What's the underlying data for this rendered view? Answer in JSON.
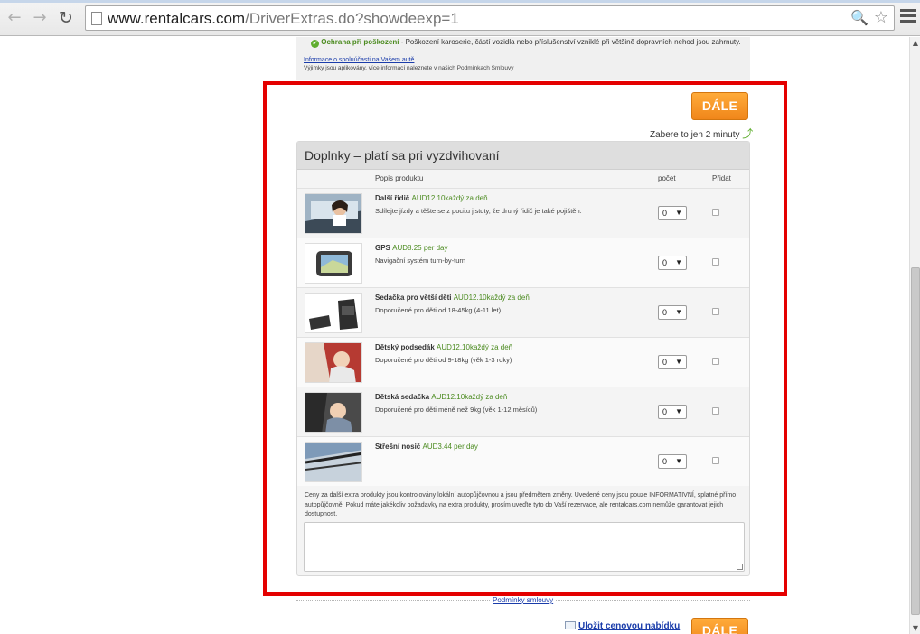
{
  "browser": {
    "url_host": "www.rentalcars.com",
    "url_path": "/DriverExtras.do?showdeexp=1",
    "back_glyph": "←",
    "forward_glyph": "→",
    "reload_glyph": "↻",
    "zoom_glyph": "🔍",
    "star_glyph": "☆"
  },
  "coverage": {
    "check_glyph": "✔",
    "title": "Ochrana při poškození",
    "text": " - Poškození karoserie, částí vozidla nebo příslušenství vzniklé při většině dopravních nehod jsou zahrnuty.",
    "excess_link": "Informace o spoluúčasti na Vašem autě",
    "exclusions_note": "Výjimky jsou aplikovány, více informací naleznete v našich Podmínkach Smlouvy"
  },
  "continue_label": "DÁLE",
  "takes_time": "Zabere to jen 2 minuty",
  "takes_arrow": "⤴",
  "extras": {
    "title": "Doplnky – platí sa pri vyzdvihovaní",
    "col_product": "Popis produktu",
    "col_count": "počet",
    "col_add": "Přidat",
    "items": [
      {
        "name": "Další řidič",
        "price": "AUD12.10každý za deň",
        "desc": "Sdílejte jízdy a těšte se z pocitu jistoty, že druhý řidič je také pojištěn.",
        "qty": "0",
        "thumb": "driver-photo"
      },
      {
        "name": "GPS",
        "price": "AUD8.25 per day",
        "desc": "Navigační systém turn-by-turn",
        "qty": "0",
        "thumb": "gps-photo"
      },
      {
        "name": "Sedačka pro větší děti",
        "price": "AUD12.10každý za deň",
        "desc": "Doporučené pro děti od 18-45kg (4-11 let)",
        "qty": "0",
        "thumb": "booster-seat-photo"
      },
      {
        "name": "Dětský podsedák",
        "price": "AUD12.10každý za deň",
        "desc": "Doporučené pro děti od 9-18kg (věk 1-3 roky)",
        "qty": "0",
        "thumb": "child-seat-photo"
      },
      {
        "name": "Dětská sedačka",
        "price": "AUD12.10každý za deň",
        "desc": "Doporučené pro děti méně než 9kg (věk 1-12 měsíců)",
        "qty": "0",
        "thumb": "baby-seat-photo"
      },
      {
        "name": "Střešní nosič",
        "price": "AUD3.44 per day",
        "desc": "",
        "qty": "0",
        "thumb": "roof-rack-photo"
      }
    ],
    "caret_glyph": "▼",
    "disclaimer": "Ceny za další extra produkty jsou kontrolovány lokální autopůjčovnou a jsou předmětem změny. Uvedené ceny jsou pouze INFORMATIVNÍ, splatné přímo autopůjčovně. Pokud máte jakékoliv požadavky na extra produkty, prosím uveďte tyto do Vaší rezervace, ale rentalcars.com nemůže garantovat jejich dostupnost."
  },
  "footer": {
    "terms_link": "Podmínky smlouvy",
    "save_quote": "Uložit cenovou nabídku"
  }
}
